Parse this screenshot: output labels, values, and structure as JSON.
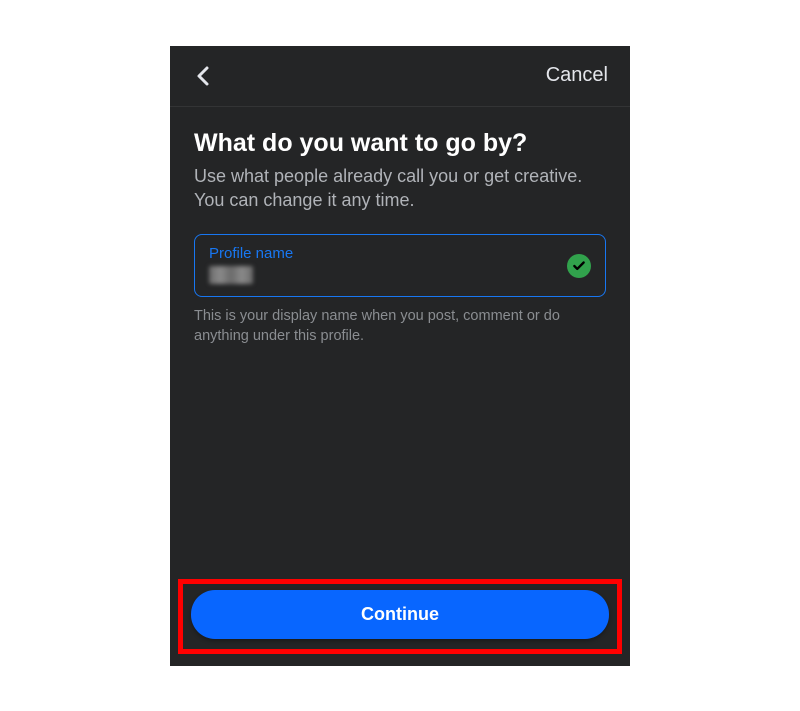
{
  "header": {
    "cancel_label": "Cancel"
  },
  "main": {
    "title": "What do you want to go by?",
    "subtitle": "Use what people already call you or get creative. You can change it any time.",
    "input_label": "Profile name",
    "helper_text": "This is your display name when you post, comment or do anything under this profile."
  },
  "footer": {
    "continue_label": "Continue"
  },
  "colors": {
    "accent": "#1877f2",
    "button": "#0866ff",
    "success": "#31a24c",
    "highlight": "#ff0000",
    "background": "#242526"
  }
}
